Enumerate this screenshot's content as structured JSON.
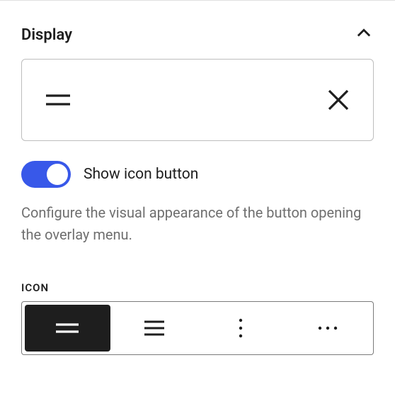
{
  "section": {
    "title": "Display",
    "expanded": true
  },
  "preview": {
    "open_icon": "hamburger-two-lines",
    "close_icon": "close-x"
  },
  "toggle": {
    "checked": true,
    "label": "Show icon button"
  },
  "description": "Configure the visual appearance of the button opening the overlay menu.",
  "icon_picker": {
    "heading": "ICON",
    "options": [
      {
        "name": "hamburger-two-lines",
        "selected": true
      },
      {
        "name": "hamburger-three-lines",
        "selected": false
      },
      {
        "name": "vertical-dots",
        "selected": false
      },
      {
        "name": "horizontal-dots",
        "selected": false
      }
    ]
  }
}
